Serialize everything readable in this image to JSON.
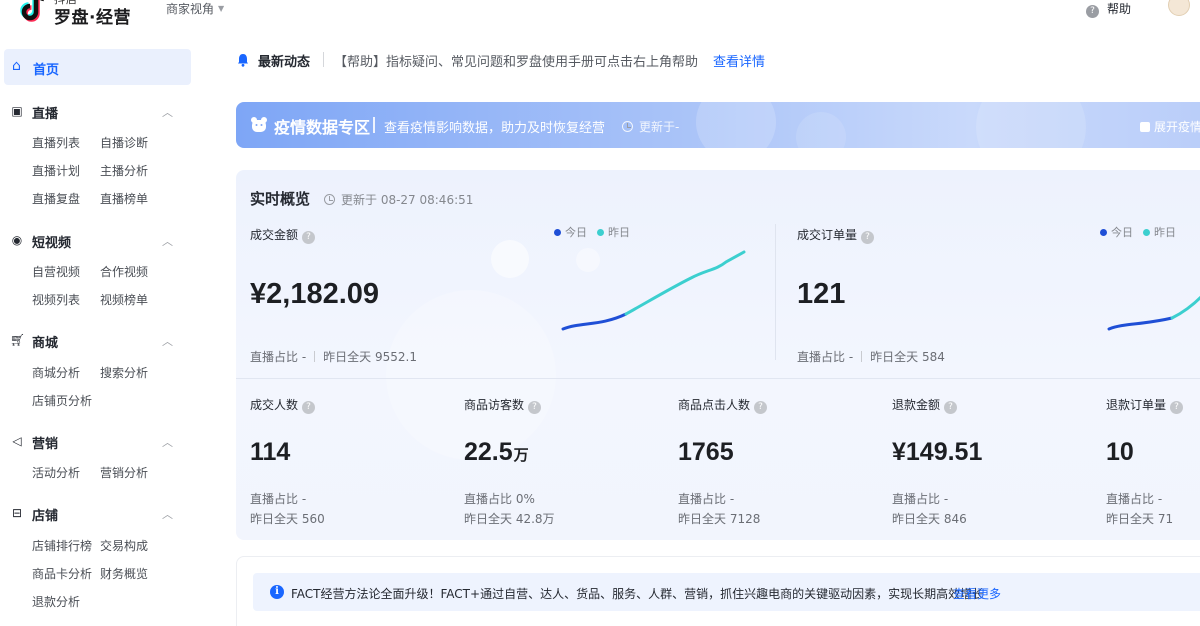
{
  "header": {
    "brand_top": "抖店",
    "brand": "罗盘·经营",
    "view_switch": "商家视角",
    "help": "帮助"
  },
  "sidebar": {
    "home": "首页",
    "groups": [
      {
        "label": "直播",
        "icon": "live-icon",
        "items": [
          "直播列表",
          "自播诊断",
          "直播计划",
          "主播分析",
          "直播复盘",
          "直播榜单"
        ]
      },
      {
        "label": "短视频",
        "icon": "video-icon",
        "items": [
          "自营视频",
          "合作视频",
          "视频列表",
          "视频榜单"
        ]
      },
      {
        "label": "商城",
        "icon": "cart-icon",
        "items": [
          "商城分析",
          "搜索分析",
          "店铺页分析"
        ]
      },
      {
        "label": "营销",
        "icon": "megaphone-icon",
        "items": [
          "活动分析",
          "营销分析"
        ]
      },
      {
        "label": "店铺",
        "icon": "shop-icon",
        "items": [
          "店铺排行榜",
          "交易构成",
          "商品卡分析",
          "财务概览",
          "退款分析"
        ]
      }
    ]
  },
  "notice": {
    "title": "最新动态",
    "text": "【帮助】指标疑问、常见问题和罗盘使用手册可点击右上角帮助",
    "link": "查看详情"
  },
  "banner": {
    "title": "疫情数据专区",
    "subtitle": "查看疫情影响数据，助力及时恢复经营",
    "updated": "更新于-",
    "expand": "展开疫情"
  },
  "realtime": {
    "title": "实时概览",
    "updated": "更新于 08-27 08:46:51",
    "legend": {
      "today": "今日",
      "yesterday": "昨日"
    },
    "colors": {
      "today": "#1f4fd6",
      "yesterday": "#3ccfcf"
    },
    "top_metrics": [
      {
        "label": "成交金额",
        "value": "¥2,182.09",
        "live_ratio": "直播占比 -",
        "yesterday_total": "昨日全天 9552.1"
      },
      {
        "label": "成交订单量",
        "value": "121",
        "live_ratio": "直播占比 -",
        "yesterday_total": "昨日全天 584"
      }
    ],
    "metrics": [
      {
        "label": "成交人数",
        "value": "114",
        "unit": "",
        "live_ratio": "直播占比 -",
        "yesterday_total": "昨日全天 560"
      },
      {
        "label": "商品访客数",
        "value": "22.5",
        "unit": "万",
        "live_ratio": "直播占比 0%",
        "yesterday_total": "昨日全天 42.8万"
      },
      {
        "label": "商品点击人数",
        "value": "1765",
        "unit": "",
        "live_ratio": "直播占比 -",
        "yesterday_total": "昨日全天 7128"
      },
      {
        "label": "退款金额",
        "value": "¥149.51",
        "unit": "",
        "live_ratio": "直播占比 -",
        "yesterday_total": "昨日全天 846"
      },
      {
        "label": "退款订单量",
        "value": "10",
        "unit": "",
        "live_ratio": "直播占比 -",
        "yesterday_total": "昨日全天 71"
      }
    ]
  },
  "fact": {
    "text": "FACT经营方法论全面升级！FACT+通过自营、达人、货品、服务、人群、营销，抓住兴趣电商的关键驱动因素，实现长期高效增长",
    "link": "查看更多"
  }
}
